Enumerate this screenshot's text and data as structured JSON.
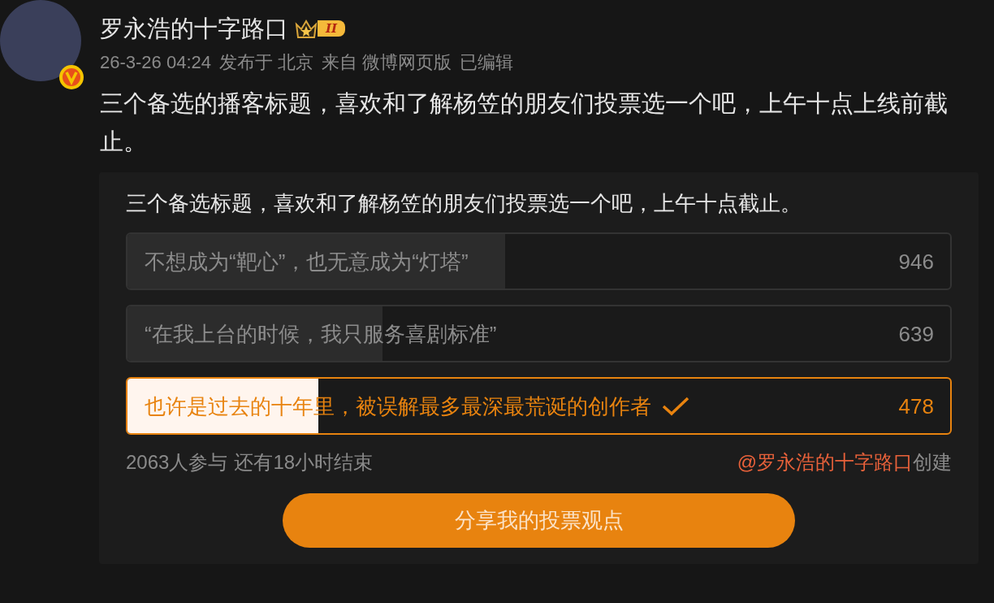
{
  "post": {
    "author": "罗永浩的十字路口",
    "badge_level": "II",
    "verified": true,
    "time": "26-3-26 04:24",
    "location": "发布于 北京",
    "source": "来自 微博网页版",
    "edited": "已编辑",
    "text": "三个备选的播客标题，喜欢和了解杨笠的朋友们投票选一个吧，上午十点上线前截止。"
  },
  "poll": {
    "title": "三个备选标题，喜欢和了解杨笠的朋友们投票选一个吧，上午十点截止。",
    "options": [
      {
        "label": "不想成为“靶心”，也无意成为“灯塔”",
        "count": "946",
        "level": 0.459,
        "selected": false
      },
      {
        "label": "“在我上台的时候，我只服务喜剧标准”",
        "count": "639",
        "level": 0.31,
        "selected": false
      },
      {
        "label": "也许是过去的十年里，被误解最多最深最荒诞的创作者",
        "count": "478",
        "level": 0.232,
        "selected": true
      }
    ],
    "participants": "2063人参与",
    "remaining": "还有18小时结束",
    "creator": "@罗永浩的十字路口",
    "created": "创建",
    "share_button": "分享我的投票观点"
  }
}
